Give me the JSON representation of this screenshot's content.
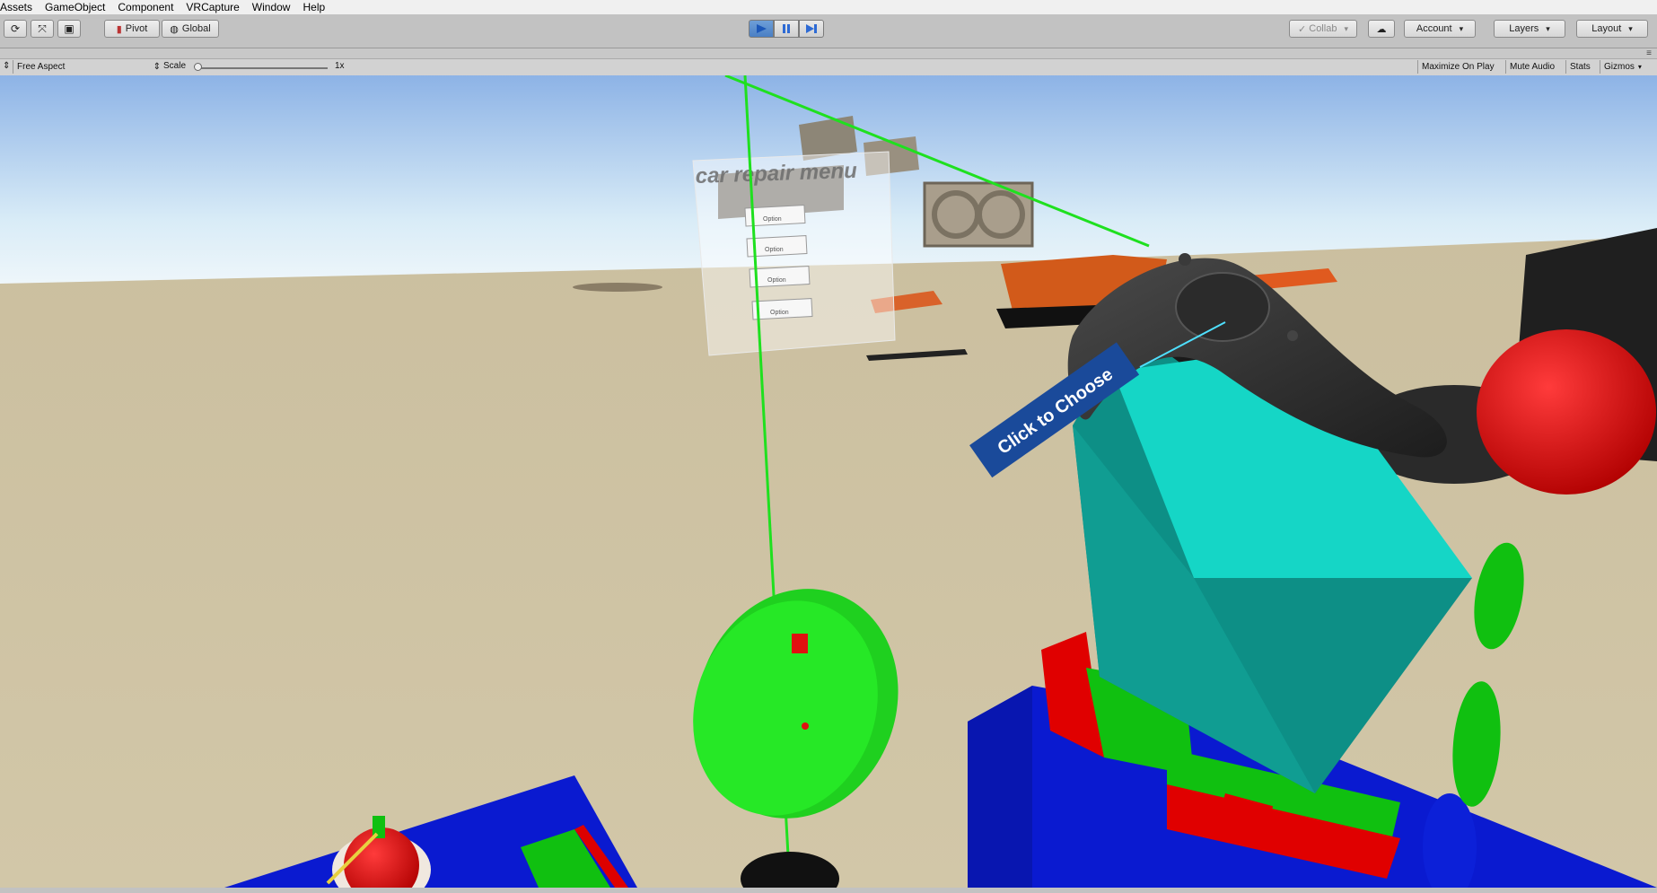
{
  "menubar": {
    "items": [
      "Assets",
      "GameObject",
      "Component",
      "VRCapture",
      "Window",
      "Help"
    ]
  },
  "toolbar": {
    "pivot_label": "Pivot",
    "global_label": "Global",
    "collab_label": "Collab",
    "account_label": "Account",
    "layers_label": "Layers",
    "layout_label": "Layout",
    "play_state": "playing"
  },
  "game_view": {
    "aspect_label": "Free Aspect",
    "scale_label": "Scale",
    "scale_value": "1x",
    "maximize_label": "Maximize On Play",
    "mute_label": "Mute Audio",
    "stats_label": "Stats",
    "gizmos_label": "Gizmos"
  },
  "scene": {
    "menu_title": "car repair menu",
    "menu_buttons": [
      "Option",
      "Option",
      "Option",
      "Option"
    ],
    "tooltip_text": "Click to Choose",
    "colors": {
      "sky_top": "#8fb4e6",
      "ground": "#cbbf9f",
      "cube": "#15d1c0",
      "pointer_line": "#1fe01f",
      "base_blue": "#0a1ad0"
    }
  }
}
